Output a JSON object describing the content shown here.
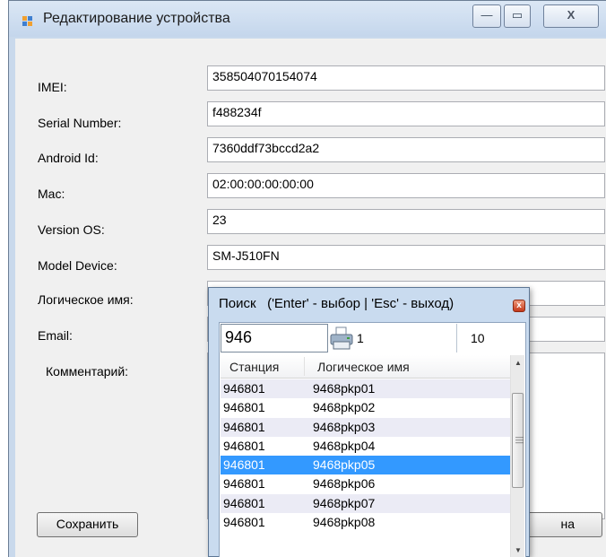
{
  "window": {
    "title": "Редактирование устройства",
    "min_glyph": "—",
    "max_glyph": "▭",
    "close_glyph": "X"
  },
  "form": {
    "fields": [
      {
        "label": "IMEI:",
        "value": "358504070154074"
      },
      {
        "label": "Serial Number:",
        "value": "f488234f"
      },
      {
        "label": "Android Id:",
        "value": "7360ddf73bccd2a2"
      },
      {
        "label": "Mac:",
        "value": "02:00:00:00:00:00"
      },
      {
        "label": "Version OS:",
        "value": "23"
      },
      {
        "label": "Model Device:",
        "value": "SM-J510FN"
      },
      {
        "label": "Логическое имя:",
        "value": ""
      },
      {
        "label": "Email:",
        "value": ""
      }
    ],
    "comment_label": "Комментарий:",
    "save_label": "Сохранить",
    "cancel_label": "на"
  },
  "popup": {
    "title": "Поиск   ('Enter' - выбор | 'Esc' - выход)",
    "close_glyph": "x",
    "query": "946",
    "count_a": "1",
    "count_b": "10",
    "columns": [
      "Станция",
      "Логическое имя"
    ],
    "rows": [
      {
        "station": "946801",
        "name": "9468pkp01",
        "state": "alt"
      },
      {
        "station": "946801",
        "name": "9468pkp02",
        "state": ""
      },
      {
        "station": "946801",
        "name": "9468pkp03",
        "state": "alt"
      },
      {
        "station": "946801",
        "name": "9468pkp04",
        "state": ""
      },
      {
        "station": "946801",
        "name": "9468pkp05",
        "state": "sel"
      },
      {
        "station": "946801",
        "name": "9468pkp06",
        "state": ""
      },
      {
        "station": "946801",
        "name": "9468pkp07",
        "state": "alt"
      },
      {
        "station": "946801",
        "name": "9468pkp08",
        "state": ""
      }
    ],
    "scroll_up_glyph": "▲",
    "scroll_down_glyph": "▼"
  },
  "colors": {
    "selection": "#3399ff",
    "alt_row": "#ebebf5",
    "window_frame": "#c9d9ec"
  }
}
